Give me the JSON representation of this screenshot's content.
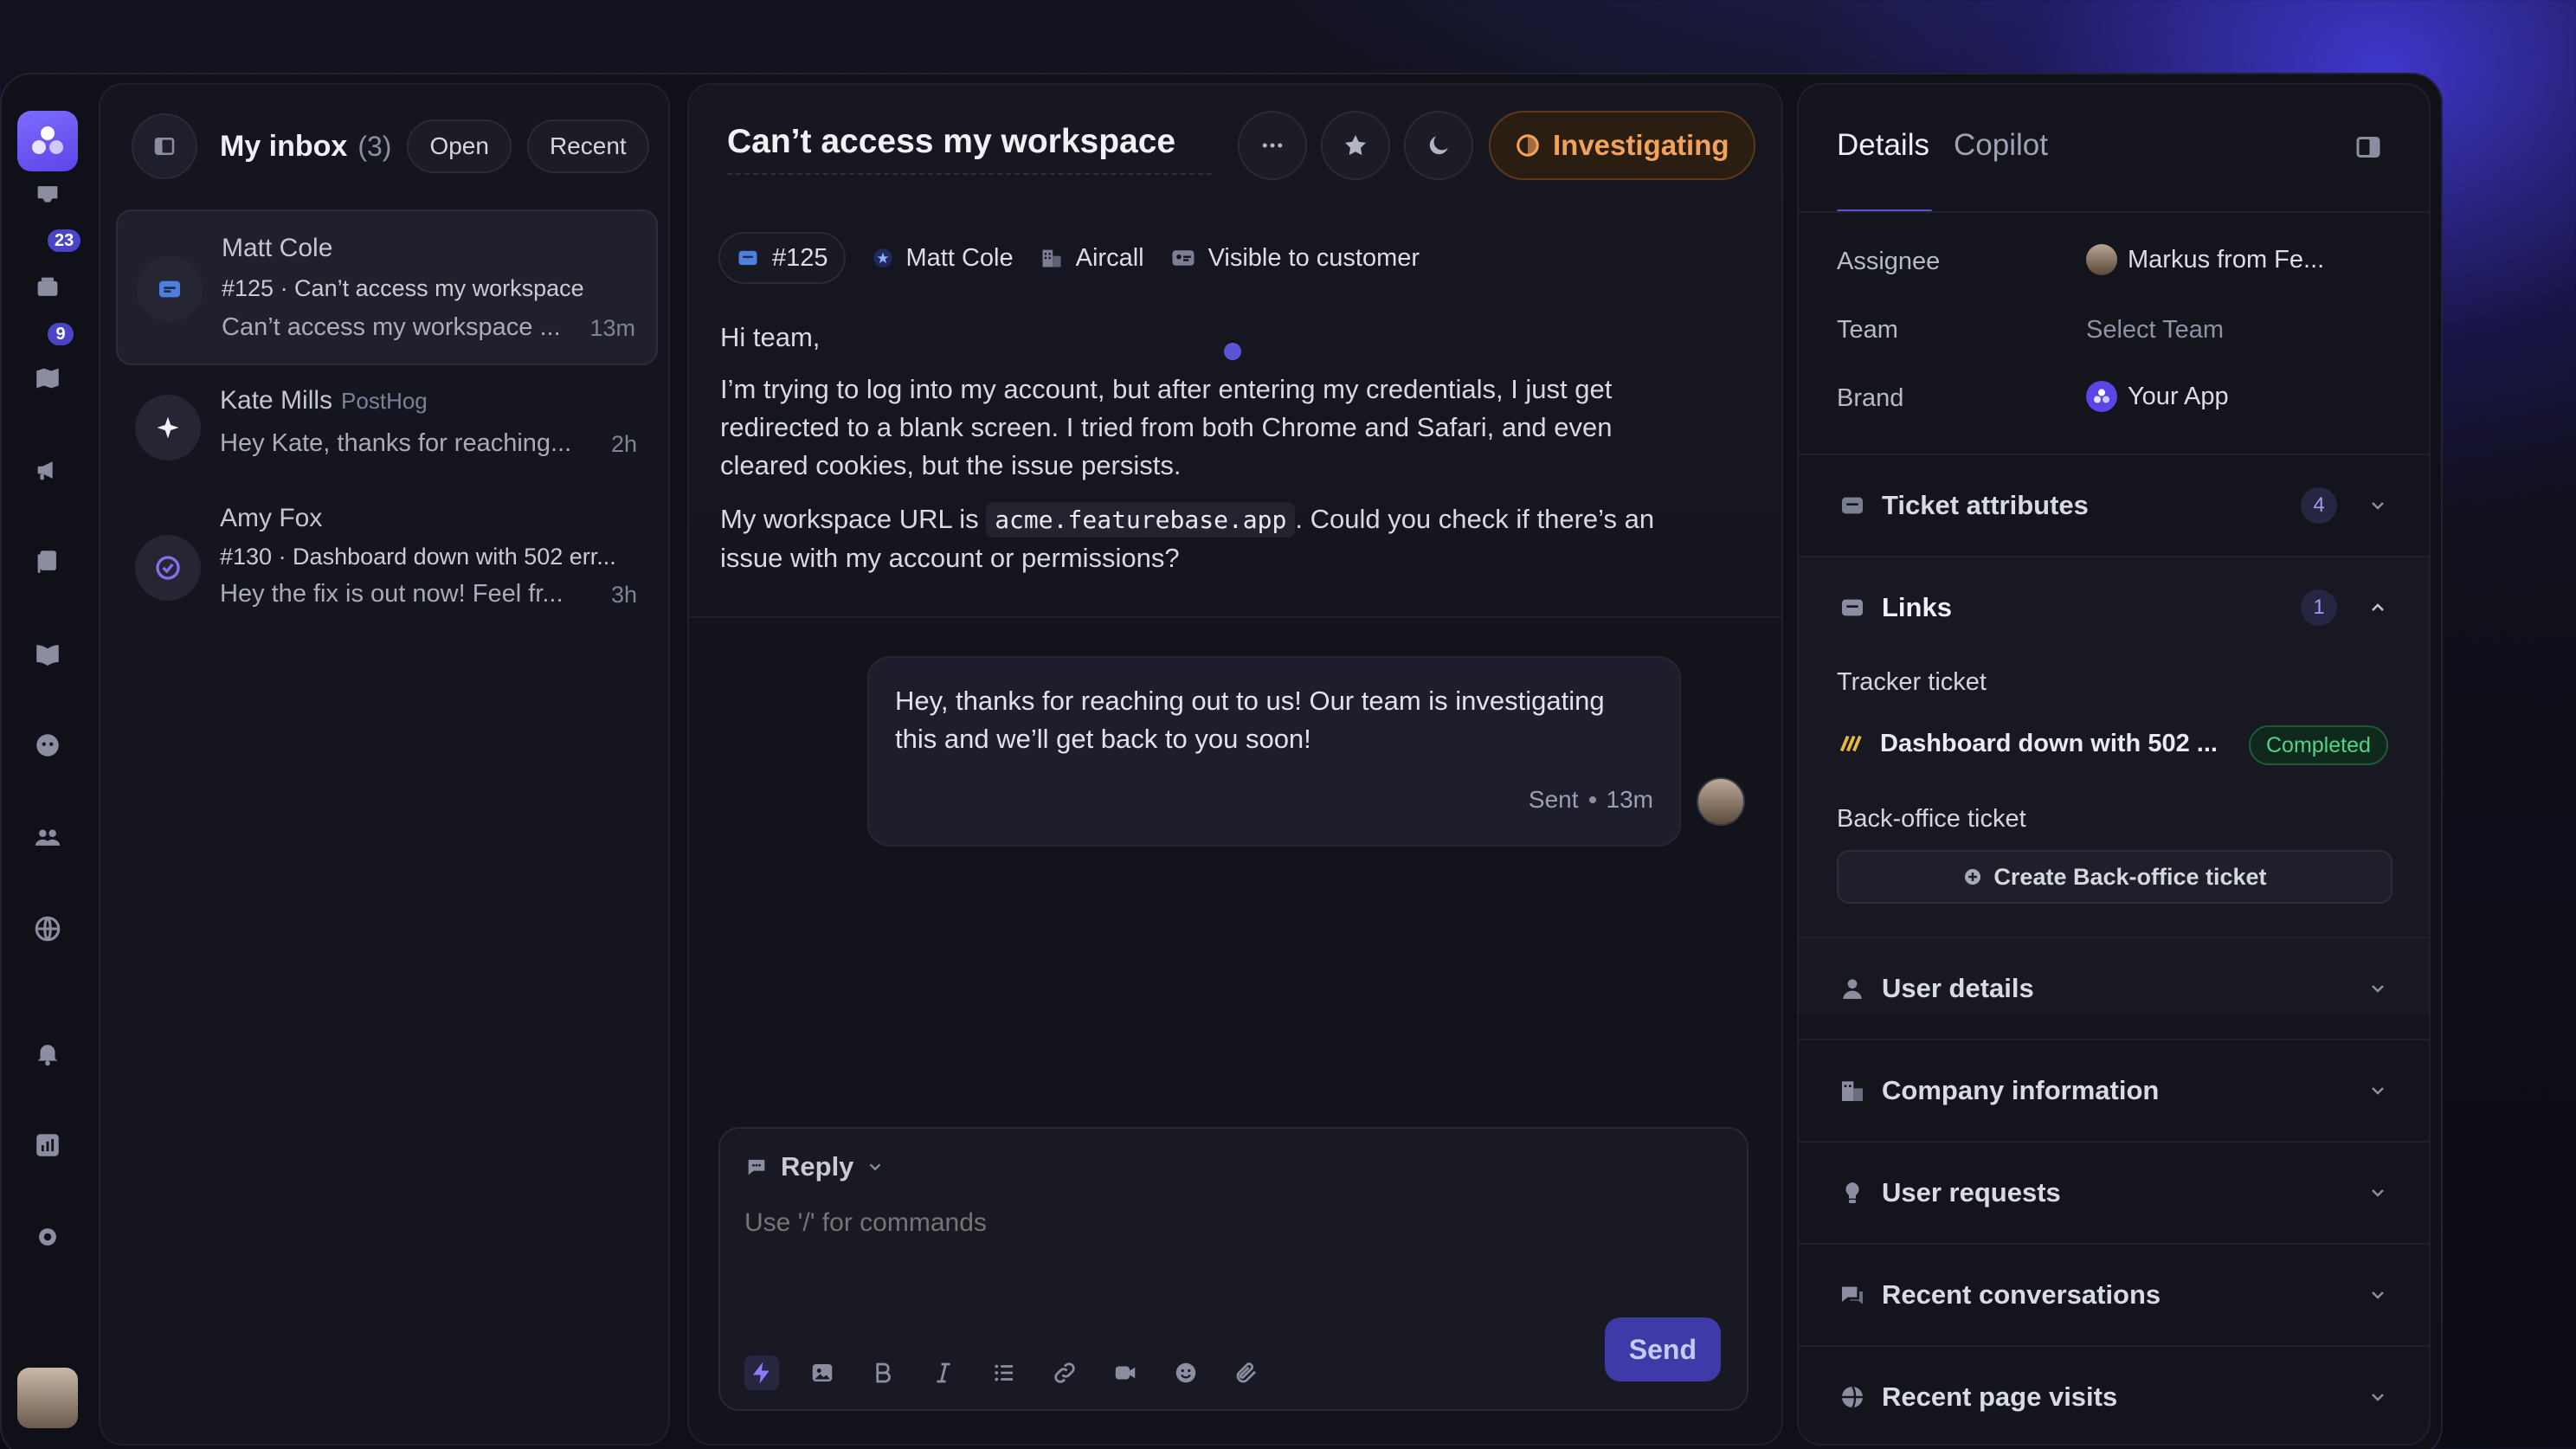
{
  "rail": {
    "badges": {
      "inbox": "23",
      "tickets": "9"
    }
  },
  "inbox": {
    "title": "My inbox",
    "count": "(3)",
    "filter_open": "Open",
    "filter_recent": "Recent",
    "conversations": [
      {
        "name": "Matt Cole",
        "company": "",
        "subject": "#125 · Can’t access my workspace",
        "preview": "Can’t access my workspace ...",
        "time": "13m"
      },
      {
        "name": "Kate Mills",
        "company": "PostHog",
        "subject": "",
        "preview": "Hey Kate, thanks for reaching...",
        "time": "2h"
      },
      {
        "name": "Amy Fox",
        "company": "",
        "subject": "#130 · Dashboard down with 502 err...",
        "preview": "Hey the fix is out now! Feel fr...",
        "time": "3h"
      }
    ]
  },
  "main": {
    "title": "Can’t access my workspace",
    "status": "Investigating",
    "meta": {
      "ticket_id": "#125",
      "customer": "Matt Cole",
      "company": "Aircall",
      "visibility": "Visible to customer"
    },
    "message": {
      "greeting": "Hi team,",
      "para1_line1": "I’m trying to log into my account, but after entering my credentials, I just get",
      "para1_line2": "redirected to a blank screen. I tried from both Chrome and Safari, and even",
      "para1_line3": "cleared cookies, but the issue persists.",
      "para2_pre": "My workspace URL is ",
      "para2_code": "acme.featurebase.app",
      "para2_post": ". Could you check if there’s an",
      "para2_line2": "issue with my account or permissions?"
    },
    "reply": {
      "line1": "Hey, thanks for reaching out to us! Our team is investigating",
      "line2": "this and we’ll get back to you soon!",
      "status": "Sent",
      "time": "13m"
    },
    "composer": {
      "mode": "Reply",
      "placeholder": "Use '/' for commands",
      "send": "Send"
    }
  },
  "details": {
    "tab_details": "Details",
    "tab_copilot": "Copilot",
    "assignee_label": "Assignee",
    "assignee_value": "Markus from Fe...",
    "team_label": "Team",
    "team_value": "Select Team",
    "brand_label": "Brand",
    "brand_value": "Your App",
    "sections": {
      "ticket_attributes": {
        "title": "Ticket attributes",
        "count": "4"
      },
      "links": {
        "title": "Links",
        "count": "1"
      },
      "user_details": {
        "title": "User details"
      },
      "company_information": {
        "title": "Company information"
      },
      "user_requests": {
        "title": "User requests"
      },
      "recent_conversations": {
        "title": "Recent conversations"
      },
      "recent_page_visits": {
        "title": "Recent page visits"
      }
    },
    "tracker_label": "Tracker ticket",
    "tracker_title": "Dashboard down with 502 ...",
    "tracker_status": "Completed",
    "backoffice_label": "Back-office ticket",
    "create_backoffice": "Create Back-office ticket"
  },
  "colors": {
    "accent": "#5c54d6",
    "status_investigating": "#f2a25a",
    "status_completed": "#51d38a"
  }
}
